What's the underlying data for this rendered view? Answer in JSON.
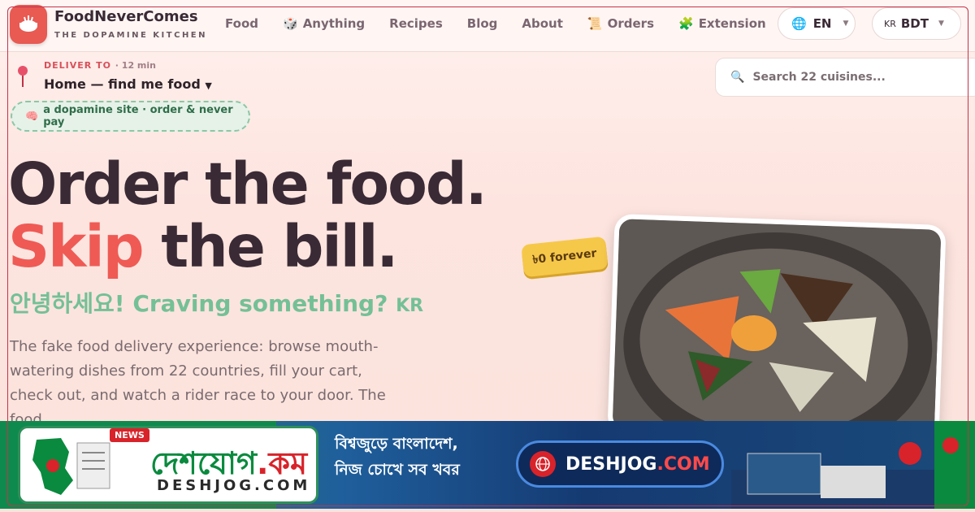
{
  "brand": {
    "name": "FoodNeverComes",
    "tagline": "THE DOPAMINE KITCHEN"
  },
  "nav": {
    "items": [
      {
        "label": "Food",
        "icon": ""
      },
      {
        "label": "Anything",
        "icon": "dice-icon"
      },
      {
        "label": "Recipes",
        "icon": ""
      },
      {
        "label": "Blog",
        "icon": ""
      },
      {
        "label": "About",
        "icon": ""
      },
      {
        "label": "Orders",
        "icon": "receipt-icon"
      },
      {
        "label": "Extension",
        "icon": "puzzle-icon"
      }
    ]
  },
  "language": {
    "value": "EN"
  },
  "currency": {
    "flag": "KR",
    "value": "BDT"
  },
  "delivery": {
    "label": "DELIVER TO",
    "eta": "· 12 min",
    "value": "Home — find me food"
  },
  "search": {
    "placeholder": "Search 22 cuisines..."
  },
  "badge": {
    "text": "a dopamine site · order & never pay"
  },
  "hero": {
    "line1": "Order the food.",
    "line2_accent": "Skip",
    "line2_rest": " the bill.",
    "greeting": "안녕하세요! Craving something?",
    "greeting_code": "KR",
    "description": "The fake food delivery experience: browse mouth-watering dishes from 22 countries, fill your cart, check out, and watch a rider race to your door. The food"
  },
  "price_tag": {
    "text": "৳0 forever"
  },
  "banner": {
    "logo_bengali_green": "দেশযোগ",
    "logo_bengali_red": ".কম",
    "logo_latin": "DESHJOG.COM",
    "news_label": "NEWS",
    "tagline1": "বিশ্বজুড়ে বাংলাদেশ,",
    "tagline2": "নিজ চোখে সব খবর",
    "button_white": "DESHJOG",
    "button_red": ".COM"
  },
  "colors": {
    "accent": "#ef5a55",
    "green": "#74c096",
    "brand": "#e85a52"
  }
}
